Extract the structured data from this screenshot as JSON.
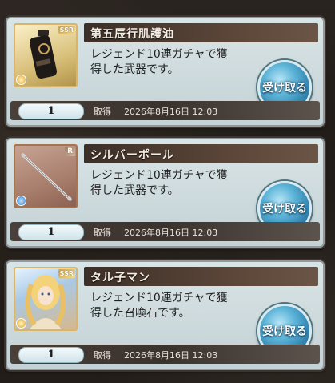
{
  "items": [
    {
      "name": "第五辰行肌護油",
      "description_line1": "レジェンド10連ガチャで獲",
      "description_line2": "得した武器です。",
      "rarity": "SSR",
      "quantity": "1",
      "acquired_label": "取得",
      "acquired_date": "2026年8月16日  12:03",
      "button_label": "受け取る",
      "element_icon": "light-element-icon"
    },
    {
      "name": "シルバーポール",
      "description_line1": "レジェンド10連ガチャで獲",
      "description_line2": "得した武器です。",
      "rarity": "R",
      "quantity": "1",
      "acquired_label": "取得",
      "acquired_date": "2026年8月16日  12:03",
      "button_label": "受け取る",
      "element_icon": "water-element-icon"
    },
    {
      "name": "タル子マン",
      "description_line1": "レジェンド10連ガチャで獲",
      "description_line2": "得した召喚石です。",
      "rarity": "SSR",
      "quantity": "1",
      "acquired_label": "取得",
      "acquired_date": "2026年8月16日  12:03",
      "button_label": "受け取る",
      "element_icon": "light-element-icon"
    }
  ],
  "colors": {
    "button_blue": "#2a7aa6",
    "title_bar_brown": "#3c2f27",
    "card_bg": "#d9e4e6",
    "ssr_gold": "#caa24e"
  }
}
